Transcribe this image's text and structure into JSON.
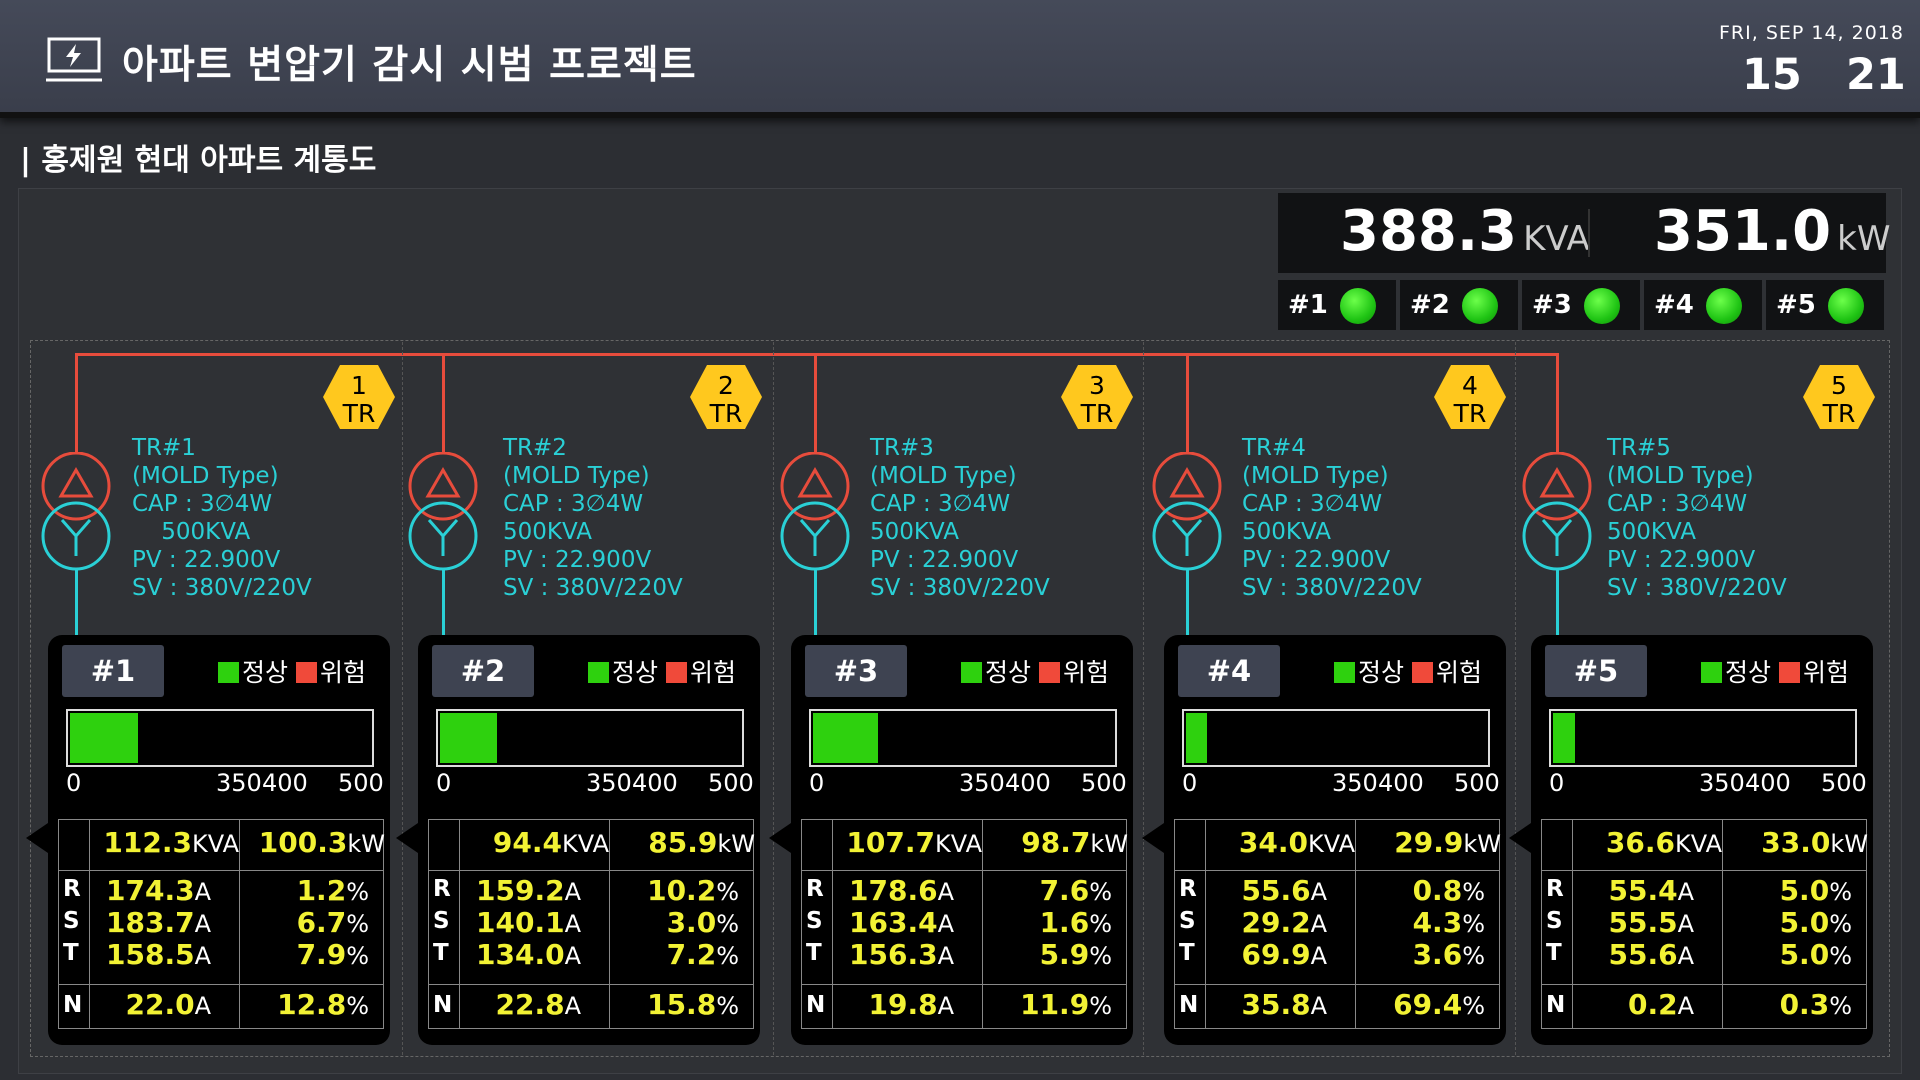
{
  "header": {
    "title": "아파트 변압기 감시 시범 프로젝트",
    "date": "FRI, SEP 14, 2018",
    "hour": "15",
    "minute": "21"
  },
  "section_title": "| 홍제원 현대 아파트 계통도",
  "totals": {
    "kva_value": "388.3",
    "kva_unit": "KVA",
    "kw_value": "351.0",
    "kw_unit": "kW"
  },
  "indicators": [
    {
      "label": "#1",
      "status_color": "#1fc414"
    },
    {
      "label": "#2",
      "status_color": "#1fc414"
    },
    {
      "label": "#3",
      "status_color": "#1fc414"
    },
    {
      "label": "#4",
      "status_color": "#1fc414"
    },
    {
      "label": "#5",
      "status_color": "#1fc414"
    }
  ],
  "legend": {
    "normal": "정상",
    "danger": "위험",
    "normal_color": "#2ed10e",
    "danger_color": "#f04a3a"
  },
  "bar_scale": {
    "min": 0,
    "max": 500,
    "ticks": [
      "0",
      "350",
      "400",
      "500"
    ]
  },
  "transformers": [
    {
      "id": "#1",
      "hex_num": "1",
      "hex_tr": "TR",
      "info": [
        "TR#1",
        "(MOLD Type)",
        "CAP : 3∅4W",
        "    500KVA",
        "PV : 22.900V",
        "SV : 380V/220V"
      ],
      "load_kva": 112.3,
      "kva": "112.3",
      "kw": "100.3",
      "phases": [
        {
          "p": "R",
          "a": "174.3",
          "pct": "1.2"
        },
        {
          "p": "S",
          "a": "183.7",
          "pct": "6.7"
        },
        {
          "p": "T",
          "a": "158.5",
          "pct": "7.9"
        }
      ],
      "n_a": "22.0",
      "n_pct": "12.8"
    },
    {
      "id": "#2",
      "hex_num": "2",
      "hex_tr": "TR",
      "info": [
        "TR#2",
        "(MOLD Type)",
        "CAP : 3∅4W",
        "500KVA",
        "PV : 22.900V",
        "SV : 380V/220V"
      ],
      "load_kva": 94.4,
      "kva": "94.4",
      "kw": "85.9",
      "phases": [
        {
          "p": "R",
          "a": "159.2",
          "pct": "10.2"
        },
        {
          "p": "S",
          "a": "140.1",
          "pct": "3.0"
        },
        {
          "p": "T",
          "a": "134.0",
          "pct": "7.2"
        }
      ],
      "n_a": "22.8",
      "n_pct": "15.8"
    },
    {
      "id": "#3",
      "hex_num": "3",
      "hex_tr": "TR",
      "info": [
        "TR#3",
        "(MOLD Type)",
        "CAP : 3∅4W",
        "500KVA",
        "PV : 22.900V",
        "SV : 380V/220V"
      ],
      "load_kva": 107.7,
      "kva": "107.7",
      "kw": "98.7",
      "phases": [
        {
          "p": "R",
          "a": "178.6",
          "pct": "7.6"
        },
        {
          "p": "S",
          "a": "163.4",
          "pct": "1.6"
        },
        {
          "p": "T",
          "a": "156.3",
          "pct": "5.9"
        }
      ],
      "n_a": "19.8",
      "n_pct": "11.9"
    },
    {
      "id": "#4",
      "hex_num": "4",
      "hex_tr": "TR",
      "info": [
        "TR#4",
        "(MOLD Type)",
        "CAP : 3∅4W",
        "500KVA",
        "PV : 22.900V",
        "SV : 380V/220V"
      ],
      "load_kva": 34.0,
      "kva": "34.0",
      "kw": "29.9",
      "phases": [
        {
          "p": "R",
          "a": "55.6",
          "pct": "0.8"
        },
        {
          "p": "S",
          "a": "29.2",
          "pct": "4.3"
        },
        {
          "p": "T",
          "a": "69.9",
          "pct": "3.6"
        }
      ],
      "n_a": "35.8",
      "n_pct": "69.4"
    },
    {
      "id": "#5",
      "hex_num": "5",
      "hex_tr": "TR",
      "info": [
        "TR#5",
        "(MOLD Type)",
        "CAP : 3∅4W",
        "500KVA",
        "PV : 22.900V",
        "SV : 380V/220V"
      ],
      "load_kva": 36.6,
      "kva": "36.6",
      "kw": "33.0",
      "phases": [
        {
          "p": "R",
          "a": "55.4",
          "pct": "5.0"
        },
        {
          "p": "S",
          "a": "55.5",
          "pct": "5.0"
        },
        {
          "p": "T",
          "a": "55.6",
          "pct": "5.0"
        }
      ],
      "n_a": "0.2",
      "n_pct": "0.3"
    }
  ],
  "units": {
    "kva": "KVA",
    "kw": "kW",
    "amp": "A",
    "pct": "%",
    "neutral": "N"
  },
  "colors": {
    "value_yellow": "#f2f234",
    "line_red": "#e74c3c",
    "line_cyan": "#2ad0d6",
    "hex_yellow": "#ffc81e"
  }
}
